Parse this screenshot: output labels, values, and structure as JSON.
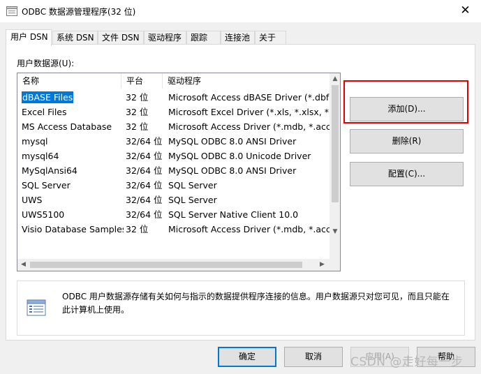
{
  "window": {
    "title": "ODBC 数据源管理程序(32 位)",
    "close_glyph": "✕"
  },
  "tabs": [
    {
      "label": "用户 DSN",
      "active": true
    },
    {
      "label": "系统 DSN",
      "active": false
    },
    {
      "label": "文件 DSN",
      "active": false
    },
    {
      "label": "驱动程序",
      "active": false
    },
    {
      "label": "跟踪",
      "active": false
    },
    {
      "label": "连接池",
      "active": false
    },
    {
      "label": "关于",
      "active": false
    }
  ],
  "user_dsn": {
    "list_label": "用户数据源(U):",
    "columns": [
      "名称",
      "平台",
      "驱动程序"
    ],
    "rows": [
      {
        "name": "dBASE Files",
        "platform": "32 位",
        "driver": "Microsoft Access dBASE Driver (*.dbf, *.ndx, *.mdx)",
        "selected": true
      },
      {
        "name": "Excel Files",
        "platform": "32 位",
        "driver": "Microsoft Excel Driver (*.xls, *.xlsx, *.xlsm, *.xlsb)",
        "selected": false
      },
      {
        "name": "MS Access Database",
        "platform": "32 位",
        "driver": "Microsoft Access Driver (*.mdb, *.accdb)",
        "selected": false
      },
      {
        "name": "mysql",
        "platform": "32/64 位",
        "driver": "MySQL ODBC 8.0 ANSI Driver",
        "selected": false
      },
      {
        "name": "mysql64",
        "platform": "32/64 位",
        "driver": "MySQL ODBC 8.0 Unicode Driver",
        "selected": false
      },
      {
        "name": "MySqlAnsi64",
        "platform": "32/64 位",
        "driver": "MySQL ODBC 8.0 ANSI Driver",
        "selected": false
      },
      {
        "name": "SQL Server",
        "platform": "32/64 位",
        "driver": "SQL Server",
        "selected": false
      },
      {
        "name": "UWS",
        "platform": "32/64 位",
        "driver": "SQL Server",
        "selected": false
      },
      {
        "name": "UWS5100",
        "platform": "32/64 位",
        "driver": "SQL Server Native Client 10.0",
        "selected": false
      },
      {
        "name": "Visio Database Samples",
        "platform": "32 位",
        "driver": "Microsoft Access Driver (*.mdb, *.accdb)",
        "selected": false
      }
    ],
    "buttons": {
      "add": "添加(D)...",
      "remove": "删除(R)",
      "configure": "配置(C)..."
    },
    "info_text": "ODBC 用户数据源存储有关如何与指示的数据提供程序连接的信息。用户数据源只对您可见，而且只能在此计算机上使用。"
  },
  "footer": {
    "ok": "确定",
    "cancel": "取消",
    "apply": "应用(A)",
    "help": "帮助"
  },
  "watermark": "CSDN @走好每一步",
  "colors": {
    "selection": "#0078d7",
    "highlight_box": "#e00000",
    "dialog_bg": "#f0f0f0"
  }
}
